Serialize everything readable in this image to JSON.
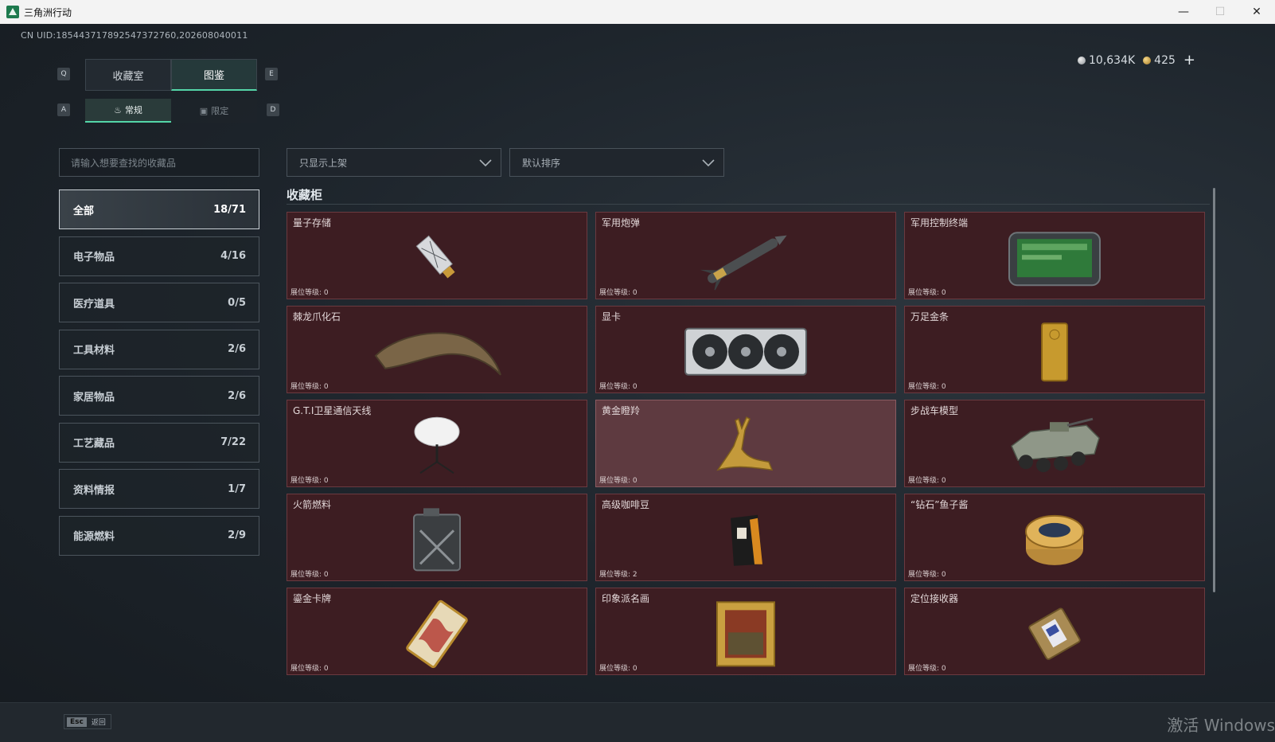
{
  "window": {
    "title": "三角洲行动",
    "minimize": "—",
    "maximize": "☐",
    "close": "✕"
  },
  "uid": "CN UID:18544371789254737276​0,2026080400​11",
  "currency": {
    "silver": "10,634K",
    "gold": "425",
    "plus": "+"
  },
  "keys": {
    "q": "Q",
    "e": "E",
    "a": "A",
    "d": "D"
  },
  "tabs_main": [
    {
      "label": "收藏室",
      "active": false
    },
    {
      "label": "图鉴",
      "active": true
    }
  ],
  "tabs_sub": [
    {
      "label": "常规",
      "active": true
    },
    {
      "label": "限定",
      "active": false
    }
  ],
  "search": {
    "placeholder": "请输入想要查找的收藏品"
  },
  "filters": {
    "shelf": "只显示上架",
    "sort": "默认排序"
  },
  "categories": [
    {
      "label": "全部",
      "count": "18/71"
    },
    {
      "label": "电子物品",
      "count": "4/16"
    },
    {
      "label": "医疗道具",
      "count": "0/5"
    },
    {
      "label": "工具材料",
      "count": "2/6"
    },
    {
      "label": "家居物品",
      "count": "2/6"
    },
    {
      "label": "工艺藏品",
      "count": "7/22"
    },
    {
      "label": "资料情报",
      "count": "1/7"
    },
    {
      "label": "能源燃料",
      "count": "2/9"
    }
  ],
  "section_title": "收藏柜",
  "items": [
    {
      "name": "量子存储",
      "level": "展位等级: 0",
      "icon": "usb-drive-icon"
    },
    {
      "name": "军用炮弹",
      "level": "展位等级: 0",
      "icon": "missile-icon"
    },
    {
      "name": "军用控制终端",
      "level": "展位等级: 0",
      "icon": "control-terminal-icon"
    },
    {
      "name": "棘龙爪化石",
      "level": "展位等级: 0",
      "icon": "claw-fossil-icon"
    },
    {
      "name": "显卡",
      "level": "展位等级: 0",
      "icon": "graphics-card-icon"
    },
    {
      "name": "万足金条",
      "level": "展位等级: 0",
      "icon": "gold-bar-icon"
    },
    {
      "name": "G.T.I卫星通信天线",
      "level": "展位等级: 0",
      "icon": "satellite-antenna-icon"
    },
    {
      "name": "黄金瞪羚",
      "level": "展位等级: 0",
      "icon": "golden-gazelle-icon"
    },
    {
      "name": "步战车模型",
      "level": "展位等级: 0",
      "icon": "ifv-model-icon"
    },
    {
      "name": "火箭燃料",
      "level": "展位等级: 0",
      "icon": "fuel-can-icon"
    },
    {
      "name": "高级咖啡豆",
      "level": "展位等级: 2",
      "icon": "coffee-bag-icon"
    },
    {
      "name": "“钻石”鱼子酱",
      "level": "展位等级: 0",
      "icon": "caviar-tin-icon"
    },
    {
      "name": "鎏金卡牌",
      "level": "展位等级: 0",
      "icon": "gilded-card-icon"
    },
    {
      "name": "印象派名画",
      "level": "展位等级: 0",
      "icon": "framed-painting-icon"
    },
    {
      "name": "定位接收器",
      "level": "展位等级: 0",
      "icon": "gps-receiver-icon"
    }
  ],
  "bottom": {
    "esc_key": "Esc",
    "esc_label": "返回"
  },
  "watermark": "激活 Windows",
  "colors": {
    "accent": "#54d6a8",
    "card_bg": "#3d1d22",
    "card_highlight": "#5e3a40"
  }
}
